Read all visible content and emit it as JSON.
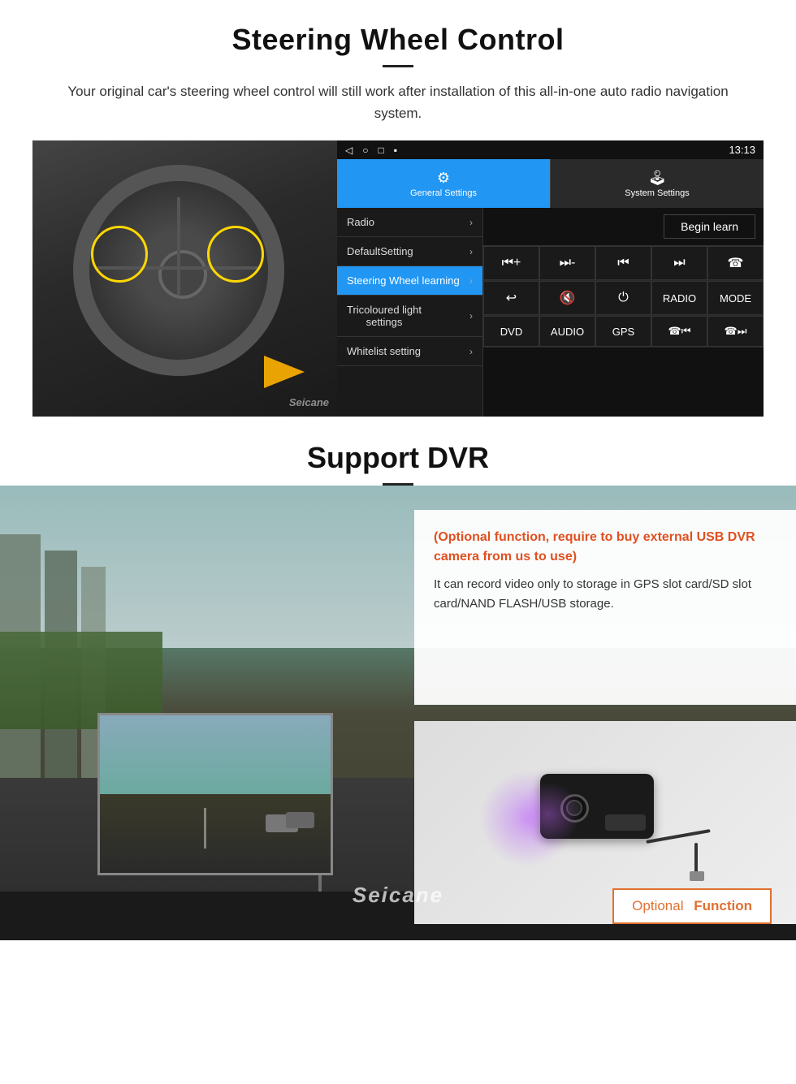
{
  "steering": {
    "title": "Steering Wheel Control",
    "subtitle": "Your original car's steering wheel control will still work after installation of this all-in-one auto radio navigation system.",
    "divider": "",
    "statusbar": {
      "icons": [
        "◁",
        "○",
        "□",
        "▪"
      ],
      "time": "13:13",
      "signal": "▾"
    },
    "header": {
      "settings_label": "General Settings",
      "system_label": "System Settings",
      "settings_icon": "⚙",
      "system_icon": "🎮"
    },
    "menu": {
      "items": [
        {
          "label": "Radio",
          "arrow": "›",
          "active": false
        },
        {
          "label": "DefaultSetting",
          "arrow": "›",
          "active": false
        },
        {
          "label": "Steering Wheel learning",
          "arrow": "›",
          "active": true
        },
        {
          "label": "Tricoloured light settings",
          "arrow": "›",
          "active": false
        },
        {
          "label": "Whitelist setting",
          "arrow": "›",
          "active": false
        }
      ]
    },
    "control": {
      "begin_learn": "Begin learn",
      "row1": [
        "⏮+",
        "⏮-",
        "⏮⏮",
        "⏭⏭",
        "☎"
      ],
      "row2": [
        "↩",
        "🔇",
        "⏻",
        "RADIO",
        "MODE"
      ],
      "row3": [
        "DVD",
        "AUDIO",
        "GPS",
        "☎⏮",
        "⏭⏭"
      ]
    }
  },
  "dvr": {
    "title": "Support DVR",
    "optional_title": "(Optional function, require to buy external USB DVR camera from us to use)",
    "description": "It can record video only to storage in GPS slot card/SD slot card/NAND FLASH/USB storage.",
    "optional_function": {
      "optional": "Optional",
      "function": "Function"
    },
    "seicane_watermark": "Seicane"
  }
}
